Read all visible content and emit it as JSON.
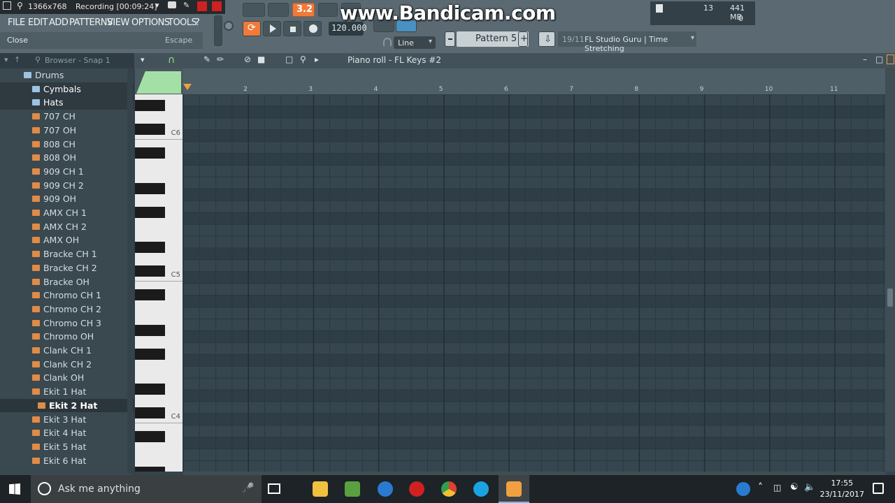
{
  "recorder": {
    "resolution": "1366x768",
    "status": "Recording [00:09:24]",
    "watermark": "www.Bandicam.com"
  },
  "menu": {
    "items": [
      "FILE",
      "EDIT",
      "ADD",
      "PATTERNS",
      "VIEW",
      "OPTIONS",
      "TOOLS",
      "?"
    ]
  },
  "hint": {
    "action": "Close",
    "shortcut": "Escape"
  },
  "transport": {
    "tempo": "120.000",
    "snap_mode": "Line",
    "indicator": "3.2",
    "indicator_color": "#f07a3a"
  },
  "pattern": {
    "label": "Pattern 5",
    "plus": "+"
  },
  "hint_panel": {
    "counter": "19/11",
    "text": "FL Studio Guru | Time Stretching"
  },
  "monitor": {
    "voices": "13",
    "memory": "441 MB",
    "cpu": "0"
  },
  "browser": {
    "header": "Browser - Snap 1",
    "items": [
      {
        "label": "Drums",
        "type": "folder",
        "indent": 1
      },
      {
        "label": "Cymbals",
        "type": "folder",
        "indent": 2,
        "selected": true
      },
      {
        "label": "Hats",
        "type": "folder",
        "indent": 2,
        "selected": true
      },
      {
        "label": "707 CH",
        "type": "file",
        "indent": 3
      },
      {
        "label": "707 OH",
        "type": "file",
        "indent": 3
      },
      {
        "label": "808 CH",
        "type": "file",
        "indent": 3
      },
      {
        "label": "808 OH",
        "type": "file",
        "indent": 3
      },
      {
        "label": "909 CH 1",
        "type": "file",
        "indent": 3
      },
      {
        "label": "909 CH 2",
        "type": "file",
        "indent": 3
      },
      {
        "label": "909 OH",
        "type": "file",
        "indent": 3
      },
      {
        "label": "AMX CH 1",
        "type": "file",
        "indent": 3
      },
      {
        "label": "AMX CH 2",
        "type": "file",
        "indent": 3
      },
      {
        "label": "AMX OH",
        "type": "file",
        "indent": 3
      },
      {
        "label": "Bracke CH 1",
        "type": "file",
        "indent": 3
      },
      {
        "label": "Bracke CH 2",
        "type": "file",
        "indent": 3
      },
      {
        "label": "Bracke OH",
        "type": "file",
        "indent": 3
      },
      {
        "label": "Chromo CH 1",
        "type": "file",
        "indent": 3
      },
      {
        "label": "Chromo CH 2",
        "type": "file",
        "indent": 3
      },
      {
        "label": "Chromo CH 3",
        "type": "file",
        "indent": 3
      },
      {
        "label": "Chromo OH",
        "type": "file",
        "indent": 3
      },
      {
        "label": "Clank CH 1",
        "type": "file",
        "indent": 3
      },
      {
        "label": "Clank CH 2",
        "type": "file",
        "indent": 3
      },
      {
        "label": "Clank OH",
        "type": "file",
        "indent": 3
      },
      {
        "label": "Ekit 1 Hat",
        "type": "file",
        "indent": 3
      },
      {
        "label": "Ekit 2 Hat",
        "type": "file",
        "indent": 4,
        "active": true
      },
      {
        "label": "Ekit 3 Hat",
        "type": "file",
        "indent": 3
      },
      {
        "label": "Ekit 4 Hat",
        "type": "file",
        "indent": 3
      },
      {
        "label": "Ekit 5 Hat",
        "type": "file",
        "indent": 3
      },
      {
        "label": "Ekit 6 Hat",
        "type": "file",
        "indent": 3
      }
    ]
  },
  "piano_roll": {
    "title": "Piano roll - FL Keys #2",
    "bars": [
      "2",
      "3",
      "4",
      "5",
      "6",
      "7",
      "8",
      "9",
      "10",
      "11"
    ],
    "octave_labels": [
      "C6",
      "C5",
      "C4"
    ]
  },
  "taskbar": {
    "search_placeholder": "Ask me anything",
    "time": "17:55",
    "date": "23/11/2017"
  }
}
